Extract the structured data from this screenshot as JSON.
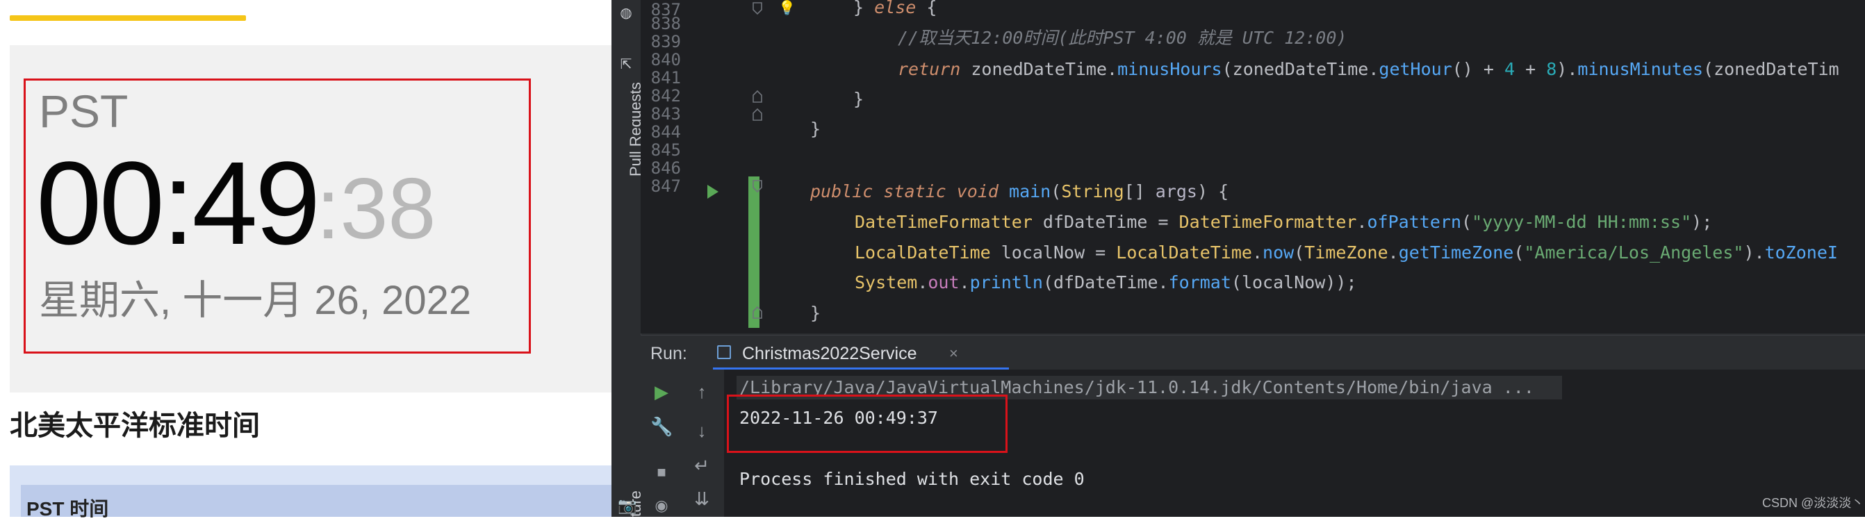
{
  "web": {
    "clock": {
      "timezone_abbr": "PST",
      "hours_minutes": "00:49",
      "seconds": ":38",
      "date": "星期六, 十一月 26, 2022"
    },
    "heading": "北美太平洋标准时间",
    "table_header": "PST 时间"
  },
  "ide": {
    "sidebar": {
      "pull_requests_label": "Pull Requests",
      "structure_label": "ture"
    },
    "editor": {
      "line_numbers": [
        "837",
        "838",
        "839",
        "840",
        "841",
        "842",
        "843",
        "844",
        "845",
        "846",
        "847"
      ]
    },
    "run": {
      "label": "Run:",
      "tab_label": "Christmas2022Service",
      "tab_close": "×",
      "command": "/Library/Java/JavaVirtualMachines/jdk-11.0.14.jdk/Contents/Home/bin/java ...",
      "output": "2022-11-26 00:49:37",
      "exit_message": "Process finished with exit code 0"
    }
  },
  "watermark": "CSDN @淡淡淡丶",
  "colors": {
    "highlight_red": "#d9121a",
    "gutter_green": "#5aa857",
    "underline_yellow": "#f5c518",
    "tab_blue": "#3574f0"
  }
}
